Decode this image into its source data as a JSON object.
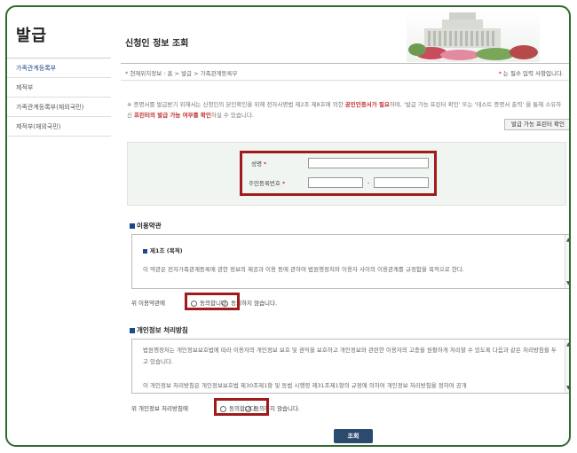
{
  "sidebar": {
    "title": "발급",
    "items": [
      {
        "label": "가족관계등록부"
      },
      {
        "label": "제적부"
      },
      {
        "label": "가족관계등록부(재외국민)"
      },
      {
        "label": "제적부(재외국민)"
      }
    ]
  },
  "header": {
    "title": "신청인 정보 조회",
    "breadcrumb": "* 현재위치정보 : 홈 > 발급 > 가족관계등록부",
    "required_note_star": "*",
    "required_note": "는 필수 입력 사항입니다."
  },
  "notice": {
    "part1": "※ 증명서를 발급받기 위해서는 신청인의 본인확인을 위해 전자서명법 제2조 제8호에 의한 ",
    "part2_red": "공인인증서가 필요",
    "part3": "하며, '발급 가능 프린터 확인' 또는 '테스트 증명서 출력' 을 통해 소유하신 ",
    "part4_red": "프린터의 발급 가능 여부를 확인",
    "part5": "하실 수 있습니다.",
    "printer_check_label": "발급 가능 프린터 확인"
  },
  "form": {
    "name_label": "성명",
    "resident_label": "주민등록번호",
    "star": "*",
    "name_value": "",
    "resident_front": "",
    "resident_back": "",
    "dash": "-"
  },
  "terms": {
    "title": "이용약관",
    "article_title": "제1조 (목적)",
    "article_text": "이 약관은 전자가족관계등록에 관한 정보의 제공과 이용 등에 관하여 법원행정처와 이용자 사이의 이용관계를 규정함을 목적으로 한다.",
    "consent_prefix": "위 이용약관에",
    "agree": "동의합니다.",
    "disagree": "동의하지 않습니다."
  },
  "privacy": {
    "title": "개인정보 처리방침",
    "para1": "법원행정처는 개인정보보호법에 따라 이용자의 개인정보 보호 및 권익을 보호하고 개인정보와 관련한 이용자의 고충을 원활하게 처리할 수 있도록 다음과 같은 처리방침을 두고 있습니다.",
    "para2": "이 개인정보 처리방침은 개인정보보호법 제30조제1항 및 동법 시행령 제31조제1항의 규정에 의하여 개인정보 처리방침을 정하여 공개",
    "consent_prefix": "위 개인정보 처리방침에",
    "agree": "동의합니다.",
    "disagree": "동의하지 않습니다."
  },
  "actions": {
    "search_label": "조회"
  },
  "colors": {
    "frame": "#2f6b2f",
    "highlight": "#a01c1c",
    "button": "#2c4a6e"
  }
}
